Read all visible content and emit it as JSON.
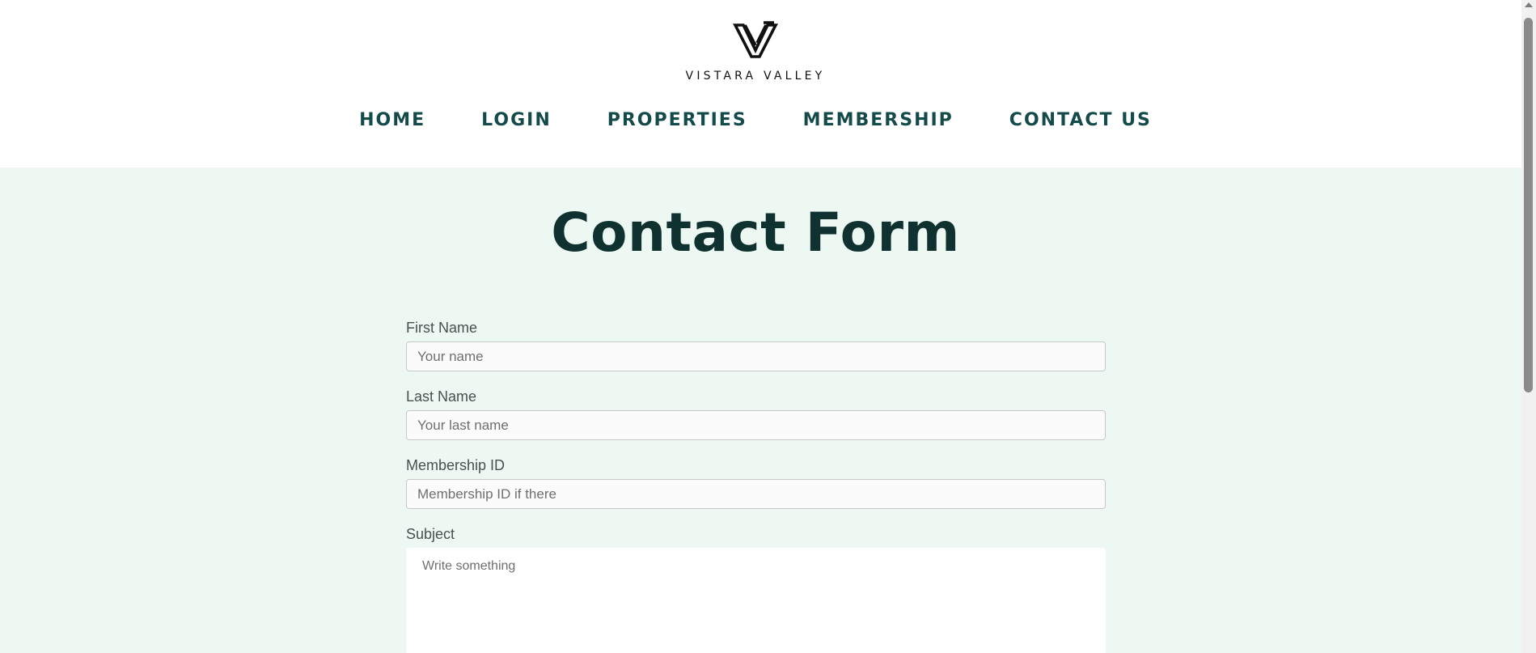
{
  "header": {
    "brand": "VISTARA VALLEY",
    "logo_icon": "v-monogram-logo-icon"
  },
  "nav": {
    "items": [
      "HOME",
      "LOGIN",
      "PROPERTIES",
      "MEMBERSHIP",
      "CONTACT US"
    ]
  },
  "main": {
    "title": "Contact Form",
    "form": {
      "first_name_label": "First Name",
      "first_name_placeholder": "Your name",
      "last_name_label": "Last Name",
      "last_name_placeholder": "Your last name",
      "membership_label": "Membership ID",
      "membership_placeholder": "Membership ID if there",
      "subject_label": "Subject",
      "subject_placeholder": "Write something"
    }
  },
  "colors": {
    "nav_text": "#144a4a",
    "title": "#0f3230",
    "content_background": "#eef8f3"
  }
}
